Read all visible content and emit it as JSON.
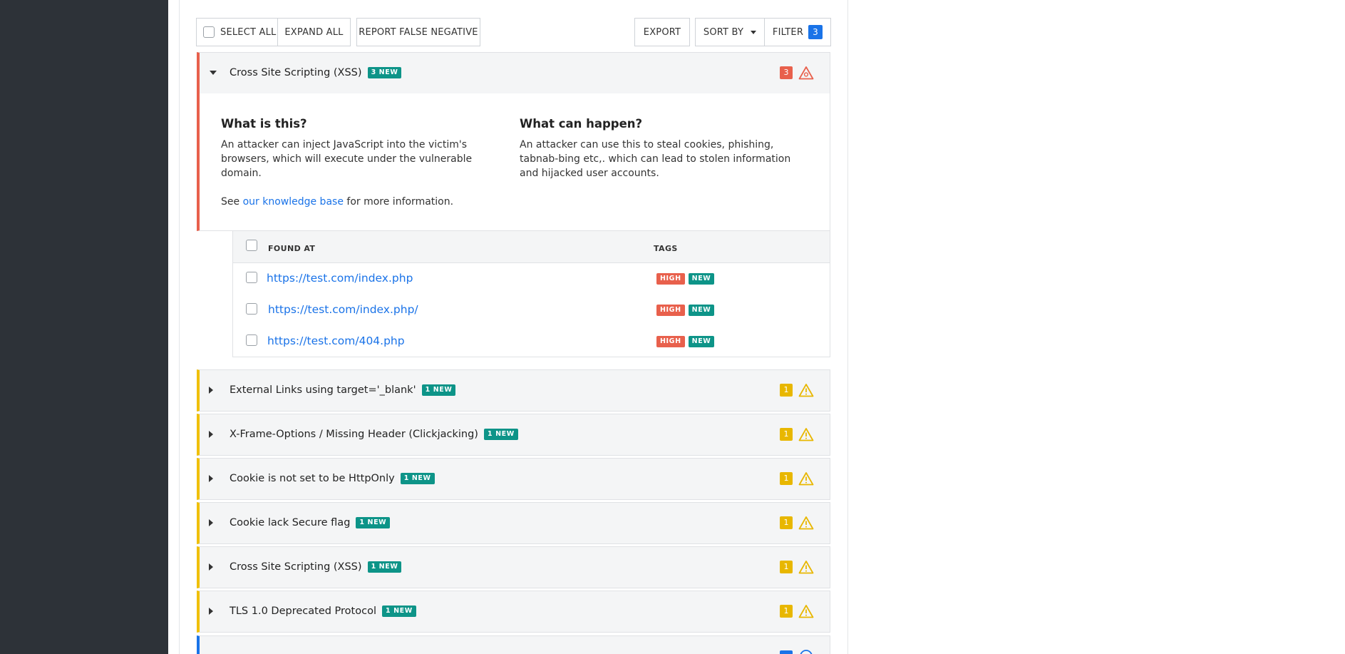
{
  "toolbar": {
    "select_all": "SELECT ALL",
    "expand_all": "EXPAND ALL",
    "report_false_negative": "REPORT FALSE NEGATIVE",
    "export": "EXPORT",
    "sort_by": "SORT BY",
    "filter": "FILTER",
    "filter_count": "3"
  },
  "expanded_issue": {
    "title": "Cross Site Scripting (XSS)",
    "new_badge": "3 NEW",
    "count": "3",
    "severity_color": "#e8604c",
    "what_is_this": {
      "heading": "What is this?",
      "text": "An attacker can inject JavaScript into the victim's browsers, which will execute under the vulnerable domain.",
      "see_prefix": "See ",
      "see_link": "our knowledge base",
      "see_suffix": " for more information."
    },
    "what_can_happen": {
      "heading": "What can happen?",
      "text": "An attacker can use this to steal cookies, phishing, tabnab-bing etc,. which can lead to stolen information and hijacked user accounts."
    },
    "table": {
      "col_found_at": "FOUND AT",
      "col_tags": "TAGS",
      "rows": [
        {
          "url": "https://test.com/index.php",
          "tag1": "HIGH",
          "tag2": "NEW"
        },
        {
          "url": "https://test.com/index.php/",
          "tag1": "HIGH",
          "tag2": "NEW"
        },
        {
          "url": "https://test.com/404.php",
          "tag1": "HIGH",
          "tag2": "NEW"
        }
      ]
    }
  },
  "collapsed_issues": [
    {
      "title": "External Links using target='_blank'",
      "new_badge": "1 NEW",
      "count": "1"
    },
    {
      "title": "X-Frame-Options / Missing Header (Clickjacking)",
      "new_badge": "1 NEW",
      "count": "1"
    },
    {
      "title": "Cookie is not set to be HttpOnly",
      "new_badge": "1 NEW",
      "count": "1"
    },
    {
      "title": "Cookie lack Secure flag",
      "new_badge": "1 NEW",
      "count": "1"
    },
    {
      "title": "Cross Site Scripting (XSS)",
      "new_badge": "1 NEW",
      "count": "1"
    },
    {
      "title": "TLS 1.0 Deprecated Protocol",
      "new_badge": "1 NEW",
      "count": "1"
    }
  ],
  "colors": {
    "sidebar": "#2d3238",
    "high": "#e8604c",
    "medium": "#e8b700",
    "info": "#1a73e8",
    "new": "#0d9488"
  },
  "icons": {
    "severity": "warning-triangle-icon",
    "expand": "caret-right-icon",
    "collapse": "caret-down-icon"
  }
}
